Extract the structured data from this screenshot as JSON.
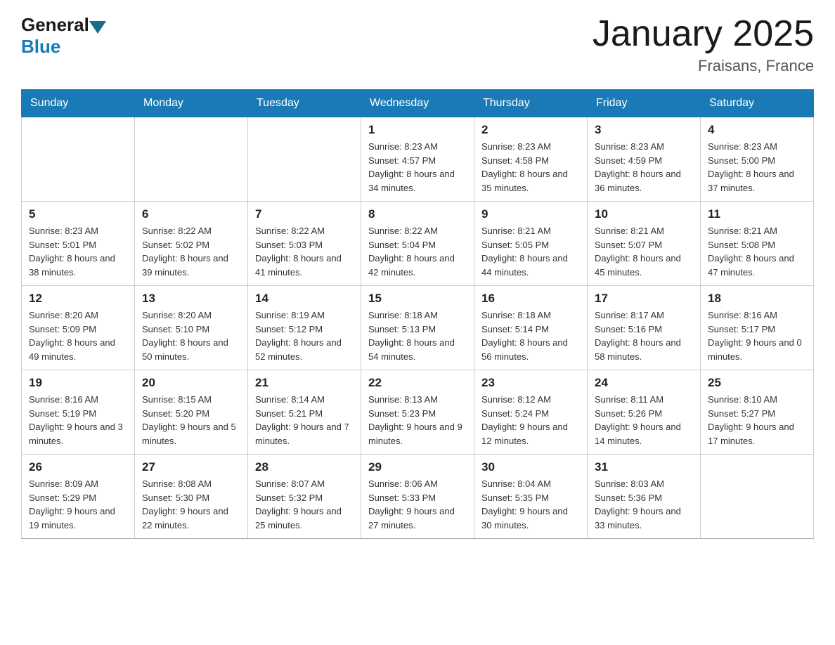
{
  "header": {
    "logo_general": "General",
    "logo_blue": "Blue",
    "title": "January 2025",
    "subtitle": "Fraisans, France"
  },
  "days_of_week": [
    "Sunday",
    "Monday",
    "Tuesday",
    "Wednesday",
    "Thursday",
    "Friday",
    "Saturday"
  ],
  "weeks": [
    [
      {
        "num": "",
        "info": ""
      },
      {
        "num": "",
        "info": ""
      },
      {
        "num": "",
        "info": ""
      },
      {
        "num": "1",
        "info": "Sunrise: 8:23 AM\nSunset: 4:57 PM\nDaylight: 8 hours\nand 34 minutes."
      },
      {
        "num": "2",
        "info": "Sunrise: 8:23 AM\nSunset: 4:58 PM\nDaylight: 8 hours\nand 35 minutes."
      },
      {
        "num": "3",
        "info": "Sunrise: 8:23 AM\nSunset: 4:59 PM\nDaylight: 8 hours\nand 36 minutes."
      },
      {
        "num": "4",
        "info": "Sunrise: 8:23 AM\nSunset: 5:00 PM\nDaylight: 8 hours\nand 37 minutes."
      }
    ],
    [
      {
        "num": "5",
        "info": "Sunrise: 8:23 AM\nSunset: 5:01 PM\nDaylight: 8 hours\nand 38 minutes."
      },
      {
        "num": "6",
        "info": "Sunrise: 8:22 AM\nSunset: 5:02 PM\nDaylight: 8 hours\nand 39 minutes."
      },
      {
        "num": "7",
        "info": "Sunrise: 8:22 AM\nSunset: 5:03 PM\nDaylight: 8 hours\nand 41 minutes."
      },
      {
        "num": "8",
        "info": "Sunrise: 8:22 AM\nSunset: 5:04 PM\nDaylight: 8 hours\nand 42 minutes."
      },
      {
        "num": "9",
        "info": "Sunrise: 8:21 AM\nSunset: 5:05 PM\nDaylight: 8 hours\nand 44 minutes."
      },
      {
        "num": "10",
        "info": "Sunrise: 8:21 AM\nSunset: 5:07 PM\nDaylight: 8 hours\nand 45 minutes."
      },
      {
        "num": "11",
        "info": "Sunrise: 8:21 AM\nSunset: 5:08 PM\nDaylight: 8 hours\nand 47 minutes."
      }
    ],
    [
      {
        "num": "12",
        "info": "Sunrise: 8:20 AM\nSunset: 5:09 PM\nDaylight: 8 hours\nand 49 minutes."
      },
      {
        "num": "13",
        "info": "Sunrise: 8:20 AM\nSunset: 5:10 PM\nDaylight: 8 hours\nand 50 minutes."
      },
      {
        "num": "14",
        "info": "Sunrise: 8:19 AM\nSunset: 5:12 PM\nDaylight: 8 hours\nand 52 minutes."
      },
      {
        "num": "15",
        "info": "Sunrise: 8:18 AM\nSunset: 5:13 PM\nDaylight: 8 hours\nand 54 minutes."
      },
      {
        "num": "16",
        "info": "Sunrise: 8:18 AM\nSunset: 5:14 PM\nDaylight: 8 hours\nand 56 minutes."
      },
      {
        "num": "17",
        "info": "Sunrise: 8:17 AM\nSunset: 5:16 PM\nDaylight: 8 hours\nand 58 minutes."
      },
      {
        "num": "18",
        "info": "Sunrise: 8:16 AM\nSunset: 5:17 PM\nDaylight: 9 hours\nand 0 minutes."
      }
    ],
    [
      {
        "num": "19",
        "info": "Sunrise: 8:16 AM\nSunset: 5:19 PM\nDaylight: 9 hours\nand 3 minutes."
      },
      {
        "num": "20",
        "info": "Sunrise: 8:15 AM\nSunset: 5:20 PM\nDaylight: 9 hours\nand 5 minutes."
      },
      {
        "num": "21",
        "info": "Sunrise: 8:14 AM\nSunset: 5:21 PM\nDaylight: 9 hours\nand 7 minutes."
      },
      {
        "num": "22",
        "info": "Sunrise: 8:13 AM\nSunset: 5:23 PM\nDaylight: 9 hours\nand 9 minutes."
      },
      {
        "num": "23",
        "info": "Sunrise: 8:12 AM\nSunset: 5:24 PM\nDaylight: 9 hours\nand 12 minutes."
      },
      {
        "num": "24",
        "info": "Sunrise: 8:11 AM\nSunset: 5:26 PM\nDaylight: 9 hours\nand 14 minutes."
      },
      {
        "num": "25",
        "info": "Sunrise: 8:10 AM\nSunset: 5:27 PM\nDaylight: 9 hours\nand 17 minutes."
      }
    ],
    [
      {
        "num": "26",
        "info": "Sunrise: 8:09 AM\nSunset: 5:29 PM\nDaylight: 9 hours\nand 19 minutes."
      },
      {
        "num": "27",
        "info": "Sunrise: 8:08 AM\nSunset: 5:30 PM\nDaylight: 9 hours\nand 22 minutes."
      },
      {
        "num": "28",
        "info": "Sunrise: 8:07 AM\nSunset: 5:32 PM\nDaylight: 9 hours\nand 25 minutes."
      },
      {
        "num": "29",
        "info": "Sunrise: 8:06 AM\nSunset: 5:33 PM\nDaylight: 9 hours\nand 27 minutes."
      },
      {
        "num": "30",
        "info": "Sunrise: 8:04 AM\nSunset: 5:35 PM\nDaylight: 9 hours\nand 30 minutes."
      },
      {
        "num": "31",
        "info": "Sunrise: 8:03 AM\nSunset: 5:36 PM\nDaylight: 9 hours\nand 33 minutes."
      },
      {
        "num": "",
        "info": ""
      }
    ]
  ]
}
